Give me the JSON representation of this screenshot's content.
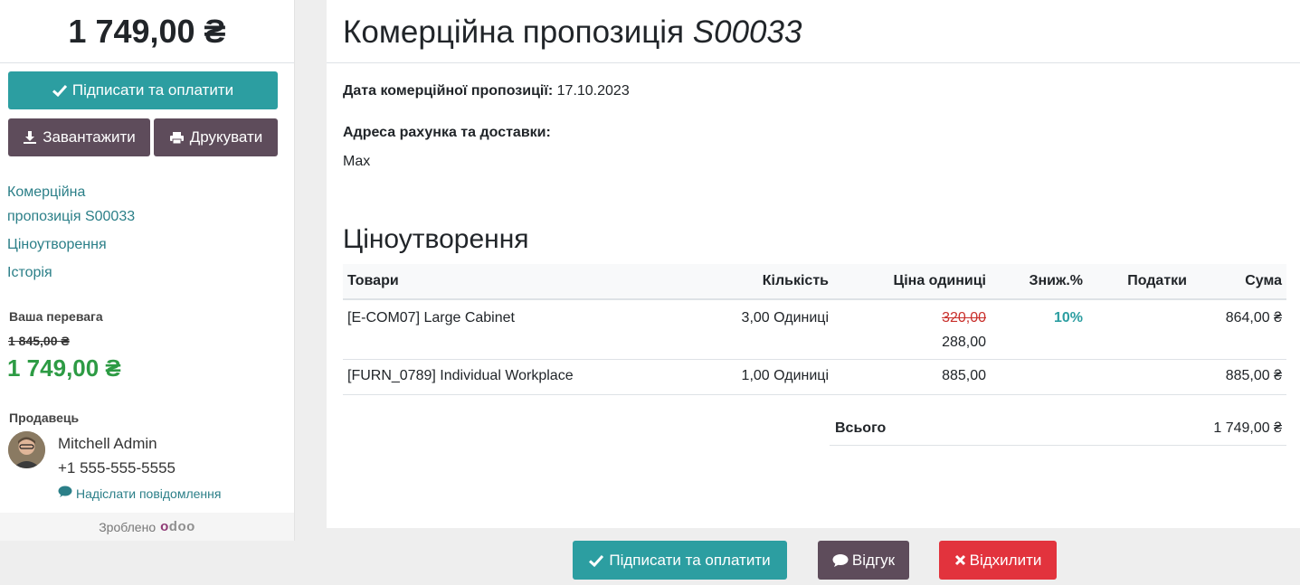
{
  "sidebar": {
    "amount": "1 749,00 ₴",
    "sign_pay": "Підписати та оплатити",
    "download": "Завантажити",
    "print": "Друкувати",
    "nav": [
      "Комерційна",
      "пропозиція S00033",
      "Ціноутворення",
      "Історія"
    ],
    "advantage_label": "Ваша перевага",
    "old_price": "1 845,00 ₴",
    "new_price": "1 749,00 ₴",
    "seller_label": "Продавець",
    "seller_name": "Mitchell Admin",
    "seller_phone": "+1 555-555-5555",
    "send_message": "Надіслати повідомлення",
    "made_by": "Зроблено",
    "made_by_logo": "odoo"
  },
  "main": {
    "title": "Комерційна пропозиція",
    "number": "S00033",
    "date_label": "Дата комерційної пропозиції:",
    "date_value": "17.10.2023",
    "address_label": "Адреса рахунка та доставки:",
    "address_value": "Max",
    "pricing_title": "Ціноутворення",
    "headers": [
      "Товари",
      "Кількість",
      "Ціна одиниці",
      "Зниж.%",
      "Податки",
      "Сума"
    ],
    "rows": [
      {
        "product": "[E-COM07] Large Cabinet",
        "qty": "3,00 Одиниці",
        "old_price": "320,00",
        "price": "288,00",
        "discount": "10%",
        "taxes": "",
        "amount": "864,00 ₴"
      },
      {
        "product": "[FURN_0789] Individual Workplace",
        "qty": "1,00 Одиниці",
        "old_price": "",
        "price": "885,00",
        "discount": "",
        "taxes": "",
        "amount": "885,00 ₴"
      }
    ],
    "total_label": "Всього",
    "total_value": "1 749,00 ₴"
  },
  "bottom": {
    "sign_pay": "Підписати та оплатити",
    "feedback": "Відгук",
    "reject": "Відхилити"
  },
  "colors": {
    "accent_teal": "#2c9ea1",
    "plum": "#5e4c5b",
    "danger": "#e2333d",
    "link": "#2b7f88",
    "price_green": "#2d9b44"
  }
}
